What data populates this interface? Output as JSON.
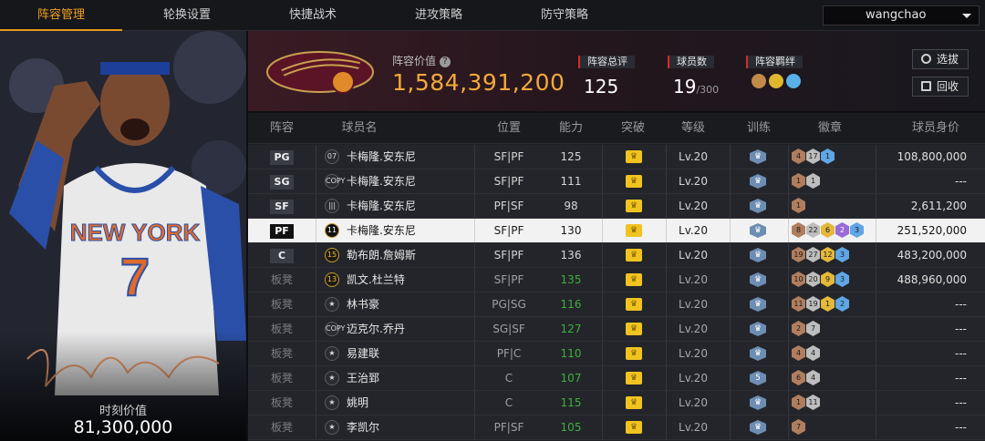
{
  "nav": {
    "tabs": [
      "阵容管理",
      "轮换设置",
      "快捷战术",
      "进攻策略",
      "防守策略"
    ],
    "active_tab": "阵容管理",
    "user": "wangchao"
  },
  "card": {
    "value_label": "时刻价值",
    "value": "81,300,000"
  },
  "summary": {
    "lineup_value_label": "阵容价值",
    "lineup_value": "1,584,391,200",
    "overall_label": "阵容总评",
    "overall_value": "125",
    "player_count_label": "球员数",
    "player_count": "19",
    "player_count_max": "/300",
    "bond_label": "阵容羁绊",
    "select_button": "选拔",
    "recycle_button": "回收"
  },
  "table": {
    "headers": [
      "阵容",
      "球员名",
      "位置",
      "能力",
      "突破",
      "等级",
      "训练",
      "徽章",
      "球员身价"
    ],
    "rows": [
      {
        "slot": "PG",
        "num": "07",
        "name": "卡梅隆.安东尼",
        "pos": "SF|PF",
        "ability": "125",
        "level": "Lv.20",
        "train": "",
        "badges": [
          [
            "bronze",
            "4"
          ],
          [
            "silver",
            "17"
          ],
          [
            "blue",
            "1"
          ]
        ],
        "value": "108,800,000"
      },
      {
        "slot": "SG",
        "num": "COPY",
        "name": "卡梅隆.安东尼",
        "pos": "SF|PF",
        "ability": "111",
        "level": "Lv.20",
        "train": "",
        "badges": [
          [
            "bronze",
            "1"
          ],
          [
            "silver",
            "1"
          ]
        ],
        "value": "---"
      },
      {
        "slot": "SF",
        "num": "|||",
        "name": "卡梅隆.安东尼",
        "pos": "PF|SF",
        "ability": "98",
        "level": "Lv.20",
        "train": "",
        "badges": [
          [
            "bronze",
            "1"
          ]
        ],
        "value": "2,611,200"
      },
      {
        "slot": "PF",
        "num": "11",
        "name": "卡梅隆.安东尼",
        "pos": "SF|PF",
        "ability": "130",
        "level": "Lv.20",
        "train": "",
        "badges": [
          [
            "bronze",
            "8"
          ],
          [
            "silver",
            "22"
          ],
          [
            "gold",
            "6"
          ],
          [
            "purple",
            "2"
          ],
          [
            "blue",
            "3"
          ]
        ],
        "value": "251,520,000"
      },
      {
        "slot": "C",
        "num": "15",
        "name": "勒布朗.詹姆斯",
        "pos": "SF|PF",
        "ability": "136",
        "level": "Lv.20",
        "train": "",
        "badges": [
          [
            "bronze",
            "19"
          ],
          [
            "silver",
            "27"
          ],
          [
            "gold",
            "12"
          ],
          [
            "blue",
            "3"
          ]
        ],
        "value": "483,200,000"
      },
      {
        "slot": "板凳",
        "num": "13",
        "name": "凯文.杜兰特",
        "pos": "SF|PF",
        "ability": "135",
        "level": "Lv.20",
        "train": "",
        "badges": [
          [
            "bronze",
            "10"
          ],
          [
            "silver",
            "20"
          ],
          [
            "gold",
            "9"
          ],
          [
            "blue",
            "3"
          ]
        ],
        "value": "488,960,000"
      },
      {
        "slot": "板凳",
        "num": "",
        "name": "林书豪",
        "pos": "PG|SG",
        "ability": "116",
        "level": "Lv.20",
        "train": "",
        "badges": [
          [
            "bronze",
            "11"
          ],
          [
            "silver",
            "19"
          ],
          [
            "gold",
            "1"
          ],
          [
            "blue",
            "2"
          ]
        ],
        "value": "---"
      },
      {
        "slot": "板凳",
        "num": "COPY",
        "name": "迈克尔.乔丹",
        "pos": "SG|SF",
        "ability": "127",
        "level": "Lv.20",
        "train": "",
        "badges": [
          [
            "bronze",
            "2"
          ],
          [
            "silver",
            "7"
          ]
        ],
        "value": "---"
      },
      {
        "slot": "板凳",
        "num": "",
        "name": "易建联",
        "pos": "PF|C",
        "ability": "110",
        "level": "Lv.20",
        "train": "",
        "badges": [
          [
            "bronze",
            "4"
          ],
          [
            "silver",
            "4"
          ]
        ],
        "value": "---"
      },
      {
        "slot": "板凳",
        "num": "",
        "name": "王治郅",
        "pos": "C",
        "ability": "107",
        "level": "Lv.20",
        "train": "5",
        "badges": [
          [
            "bronze",
            "6"
          ],
          [
            "silver",
            "4"
          ]
        ],
        "value": "---"
      },
      {
        "slot": "板凳",
        "num": "",
        "name": "姚明",
        "pos": "C",
        "ability": "115",
        "level": "Lv.20",
        "train": "",
        "badges": [
          [
            "bronze",
            "1"
          ],
          [
            "silver",
            "11"
          ]
        ],
        "value": "---"
      },
      {
        "slot": "板凳",
        "num": "",
        "name": "李凯尔",
        "pos": "PF|SF",
        "ability": "105",
        "level": "Lv.20",
        "train": "",
        "badges": [
          [
            "bronze",
            "7"
          ]
        ],
        "value": "---"
      }
    ]
  }
}
